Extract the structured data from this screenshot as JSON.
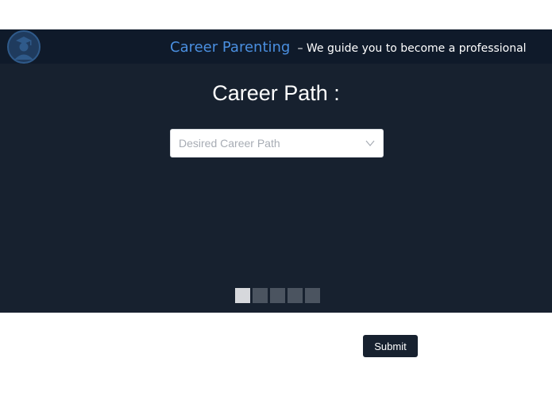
{
  "header": {
    "brand": "Career Parenting",
    "tagline": "– We guide you to become a professional",
    "logo_icon": "graduate-icon"
  },
  "main": {
    "title": "Career Path :",
    "select": {
      "placeholder": "Desired Career Path",
      "chevron_icon": "chevron-down-icon"
    },
    "pager": {
      "total": 5,
      "active_index": 0
    }
  },
  "footer": {
    "submit_label": "Submit"
  },
  "colors": {
    "header_bg": "#0f1a2a",
    "main_bg": "#17212f",
    "brand": "#4a8fe0"
  }
}
